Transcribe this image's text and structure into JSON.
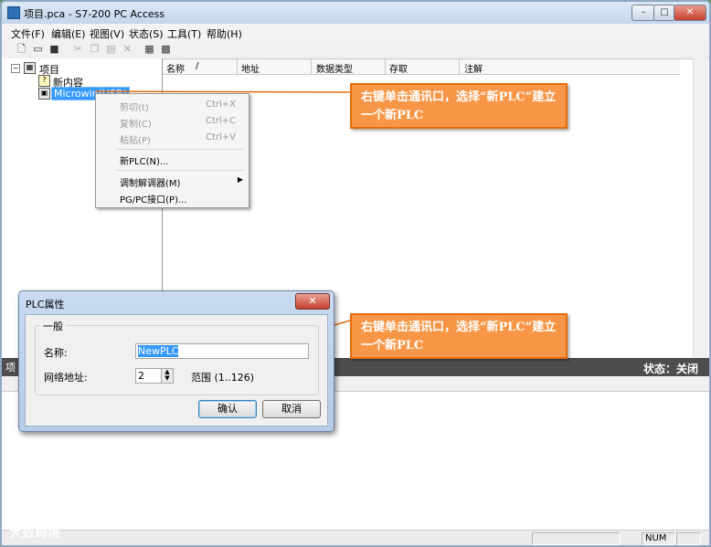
{
  "window": {
    "title": "项目.pca - S7-200 PC Access",
    "minimize_label": "–",
    "maximize_label": "□",
    "close_label": "✕"
  },
  "menubar": [
    "文件(F)",
    "编辑(E)",
    "视图(V)",
    "状态(S)",
    "工具(T)",
    "帮助(H)"
  ],
  "toolbar_icons": [
    "new-file-icon",
    "open-folder-icon",
    "save-icon",
    "cut-icon",
    "copy-icon",
    "paste-icon",
    "delete-icon",
    "import-icon",
    "export-icon"
  ],
  "tree": {
    "root_label": "项目",
    "items": [
      {
        "label": "新内容",
        "icon": "question-icon"
      },
      {
        "label": "Microwin(USB)",
        "icon": "network-pc-icon",
        "selected": true
      }
    ]
  },
  "list_columns": [
    "名称",
    "/",
    "地址",
    "数据类型",
    "存取",
    "注解"
  ],
  "context_menu": {
    "items": [
      {
        "label": "剪切(t)",
        "shortcut": "Ctrl+X",
        "enabled": false
      },
      {
        "label": "复制(C)",
        "shortcut": "Ctrl+C",
        "enabled": false
      },
      {
        "label": "粘贴(P)",
        "shortcut": "Ctrl+V",
        "enabled": false
      },
      {
        "label": "新PLC(N)...",
        "shortcut": "",
        "enabled": true
      },
      {
        "label": "调制解调器(M)",
        "shortcut": "",
        "enabled": true,
        "submenu": true
      },
      {
        "label": "PG/PC接口(P)...",
        "shortcut": "",
        "enabled": true
      }
    ]
  },
  "callouts": [
    {
      "text": "右键单击通讯口，选择“新PLC”建立一个新PLC"
    },
    {
      "text": "右键单击通讯口，选择“新PLC”建立一个新PLC"
    }
  ],
  "status_strip": {
    "text": "状态：关闭",
    "left_fragment": "项"
  },
  "statusbar": {
    "num_label": "NUM"
  },
  "watermark": "大数跨境",
  "colors": {
    "callout_fill": "#f79646",
    "callout_border": "#e46c0a",
    "selection": "#3399ff"
  },
  "dialog": {
    "title": "PLC属性",
    "close_label": "✕",
    "group_title": "一般",
    "name_label": "名称:",
    "name_value": "NewPLC",
    "address_label": "网络地址:",
    "address_value": "2",
    "range_text": "范围 (1..126)",
    "ok_label": "确认",
    "cancel_label": "取消"
  }
}
